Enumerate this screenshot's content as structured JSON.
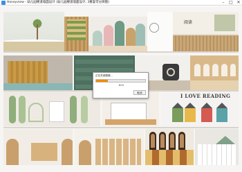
{
  "window": {
    "title": "Honeyview - 幼儿园楼道墙面设计 (幼儿园楼道墙面设计, 3重复可分辨图)",
    "minimize": "–",
    "maximize": "□",
    "close": "✕",
    "app_icon": "honeyview-app-icon"
  },
  "poster": {
    "reading_heading": "I LOVE READING",
    "note": "幼",
    "sign": "阅读"
  },
  "dialog": {
    "title": "正在关闭图像...",
    "percent_text": "61%",
    "progress": 0.24,
    "cancel_label": "取消"
  },
  "colors": {
    "progress": "#f08c00",
    "house_red": "#d45a52",
    "house_teal": "#5aa2a8",
    "house_green": "#7a9d5b",
    "house_yellow": "#e8b84a"
  }
}
